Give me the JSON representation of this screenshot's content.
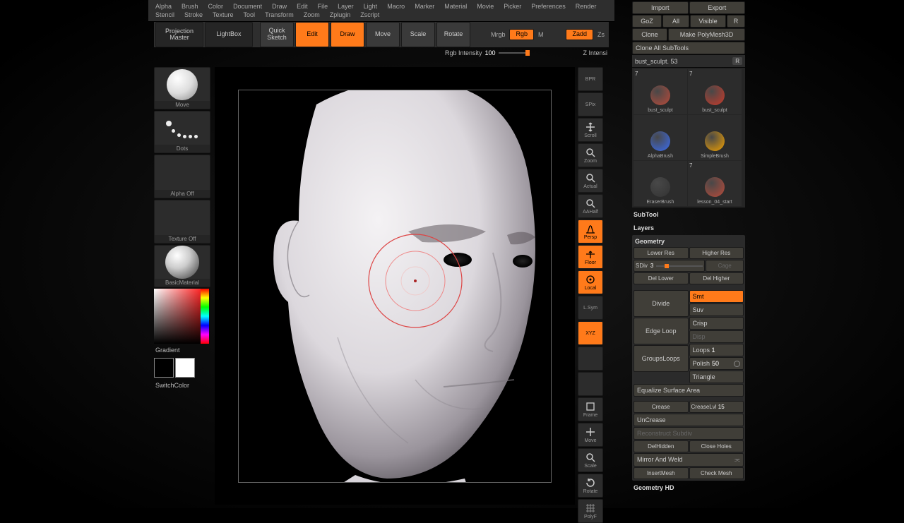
{
  "menubar": [
    "Alpha",
    "Brush",
    "Color",
    "Document",
    "Draw",
    "Edit",
    "File",
    "Layer",
    "Light",
    "Macro",
    "Marker",
    "Material",
    "Movie",
    "Picker",
    "Preferences",
    "Render",
    "Stencil",
    "Stroke",
    "Texture",
    "Tool",
    "Transform",
    "Zoom",
    "Zplugin",
    "Zscript"
  ],
  "topbar": {
    "projection": "Projection\nMaster",
    "lightbox": "LightBox",
    "quick": "Quick\nSketch",
    "edit": "Edit",
    "draw": "Draw",
    "move": "Move",
    "scale": "Scale",
    "rotate": "Rotate",
    "mrgb": "Mrgb",
    "rgb": "Rgb",
    "m": "M",
    "zadd": "Zadd",
    "zs": "Zs",
    "rgbint_label": "Rgb Intensity",
    "rgbint_val": "100",
    "zint": "Z Intensi"
  },
  "left": {
    "brush": "Move",
    "stroke": "Dots",
    "alpha": "Alpha Off",
    "texture": "Texture Off",
    "material": "BasicMaterial",
    "gradient": "Gradient",
    "switch": "SwitchColor"
  },
  "right_icons": [
    "BPR",
    "SPix",
    "Scroll",
    "Zoom",
    "Actual",
    "AAHalf",
    "Persp",
    "Floor",
    "Local",
    "L.Sym",
    "XYZ",
    "",
    "",
    "Frame",
    "Move",
    "Scale",
    "Rotate",
    "PolyF"
  ],
  "right_orange": {
    "Persp": true,
    "Floor": true,
    "Local": true,
    "XYZ": true
  },
  "panel": {
    "import": "Import",
    "export": "Export",
    "goz": "GoZ",
    "all": "All",
    "visible": "Visible",
    "r1": "R",
    "clone": "Clone",
    "make": "Make PolyMesh3D",
    "cloneall": "Clone All SubTools",
    "toolname": "bust_sculpt. 53",
    "r2": "R",
    "thumbs": [
      {
        "n": "7",
        "label": "bust_sculpt",
        "color": "#b84a3a"
      },
      {
        "n": "7",
        "label": "bust_sculpt",
        "color": "#c93a2a"
      },
      {
        "n": "",
        "label": "AlphaBrush",
        "color": "#3a6cf0"
      },
      {
        "n": "",
        "label": "SimpleBrush",
        "color": "#f0a000"
      },
      {
        "n": "",
        "label": "EraserBrush",
        "color": "#333"
      },
      {
        "n": "7",
        "label": "lesson_04_start",
        "color": "#b84a3a"
      }
    ],
    "subtool": "SubTool",
    "layers": "Layers",
    "geometry": "Geometry",
    "lower": "Lower Res",
    "higher": "Higher Res",
    "sdiv_label": "SDiv",
    "sdiv_val": "3",
    "cage": "Cage",
    "dellower": "Del Lower",
    "delhigher": "Del Higher",
    "divide": "Divide",
    "smt": "Smt",
    "suv": "Suv",
    "crisp": "Crisp",
    "disp": "Disp",
    "edgeloop": "Edge Loop",
    "loops_l": "Loops",
    "loops_v": "1",
    "groupsloops": "GroupsLoops",
    "polish_l": "Polish",
    "polish_v": "50",
    "triangle": "Triangle",
    "equalize": "Equalize Surface Area",
    "crease": "Crease",
    "creaselvl_l": "CreaseLvl",
    "creaselvl_v": "15",
    "uncrease": "UnCrease",
    "reconstruct": "Reconstruct Subdiv",
    "delhidden": "DelHidden",
    "closeholes": "Close Holes",
    "mirror": "Mirror And Weld",
    "insert": "InsertMesh",
    "check": "Check Mesh",
    "geomhd": "Geometry HD"
  }
}
